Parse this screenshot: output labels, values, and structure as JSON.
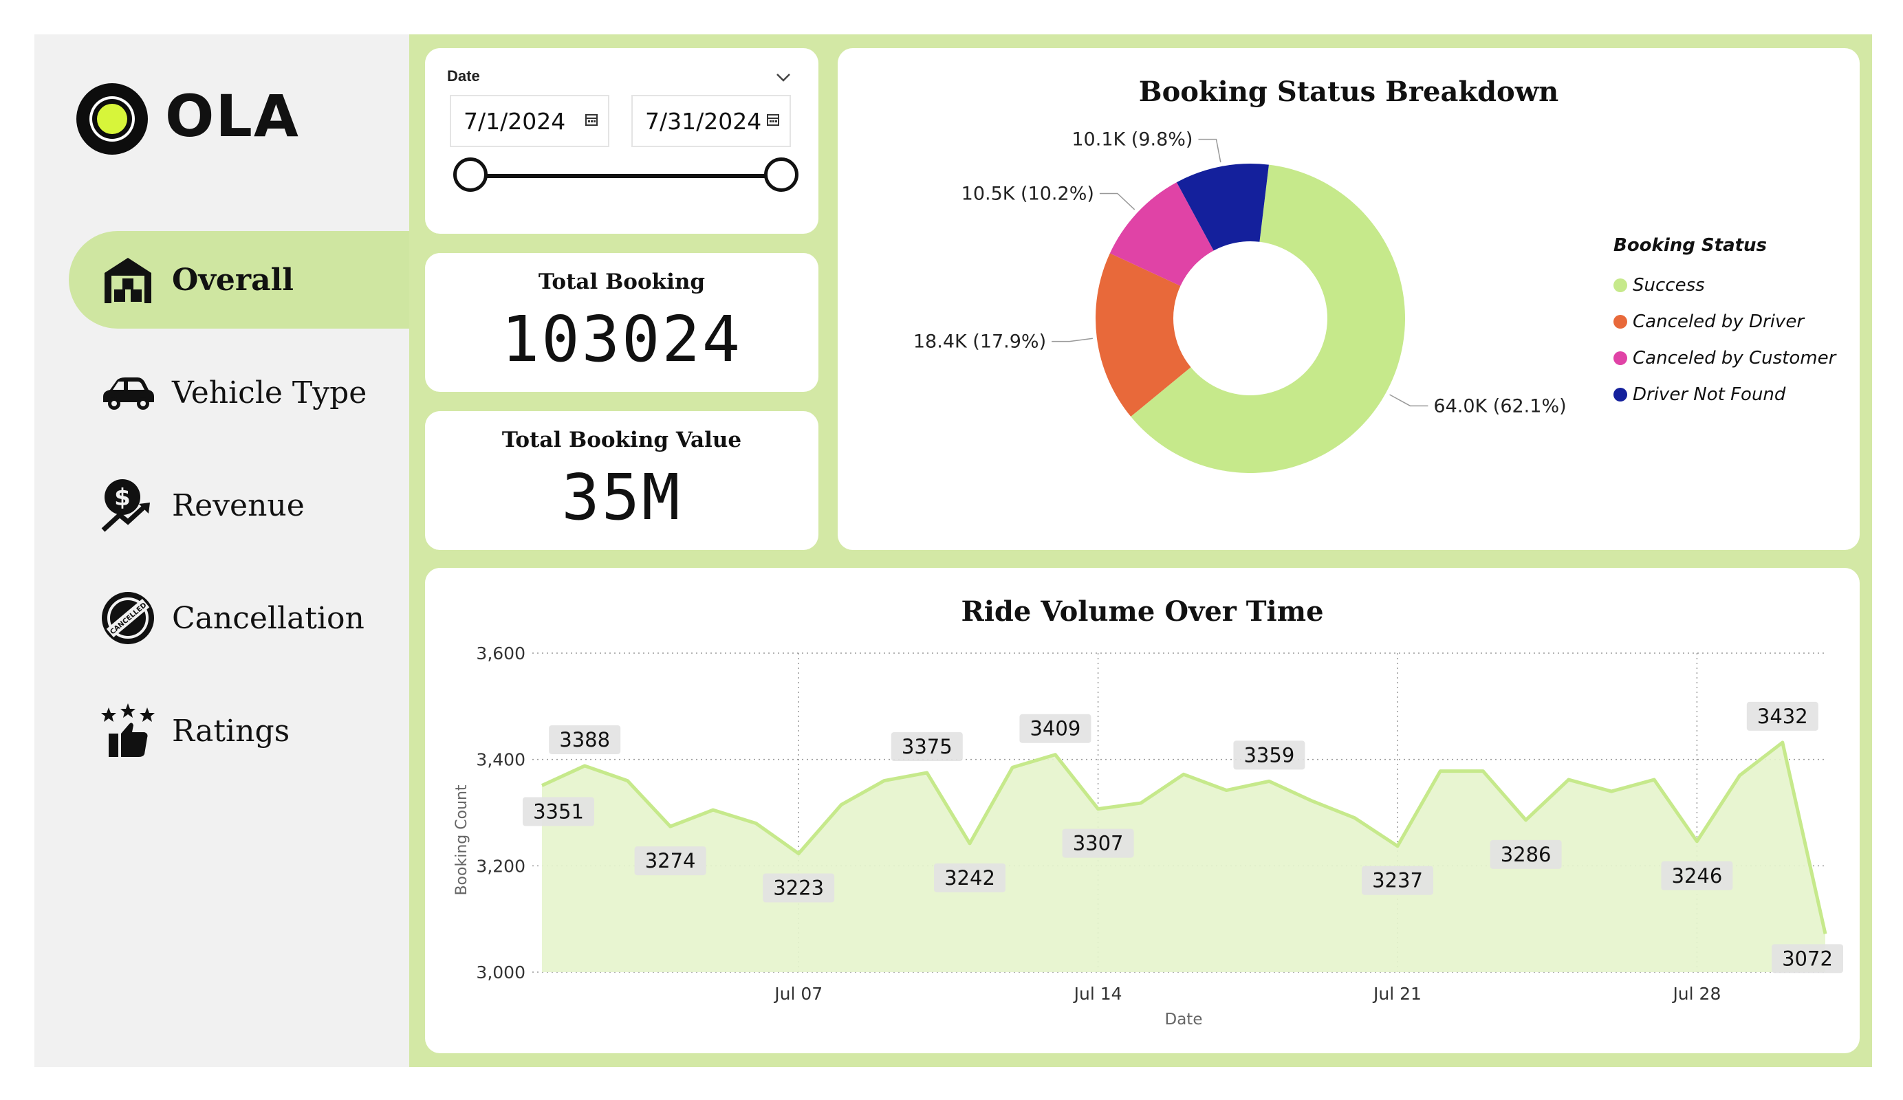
{
  "brand": {
    "name": "OLA",
    "accent": "#d7f53a",
    "sidebar_active_bg": "#cfe6a1"
  },
  "nav": {
    "items": [
      {
        "label": "Overall",
        "icon": "warehouse-icon",
        "active": true
      },
      {
        "label": "Vehicle Type",
        "icon": "car-icon",
        "active": false
      },
      {
        "label": "Revenue",
        "icon": "revenue-icon",
        "active": false
      },
      {
        "label": "Cancellation",
        "icon": "cancelled-stamp-icon",
        "active": false
      },
      {
        "label": "Ratings",
        "icon": "thumbs-up-stars-icon",
        "active": false
      }
    ]
  },
  "date_filter": {
    "label": "Date",
    "start": "7/1/2024",
    "end": "7/31/2024",
    "chevron_icon": "chevron-down-icon",
    "calendar_icon": "calendar-icon"
  },
  "kpis": {
    "total_booking": {
      "title": "Total Booking",
      "value": "103024"
    },
    "total_booking_value": {
      "title": "Total Booking Value",
      "value": "35M"
    }
  },
  "booking_status": {
    "legend_title": "Booking Status",
    "slices": [
      {
        "name": "Success",
        "value": 64.0,
        "label": "64.0K (62.1%)",
        "color": "#c6e98b"
      },
      {
        "name": "Canceled by Driver",
        "value": 18.4,
        "label": "18.4K (17.9%)",
        "color": "#e8693a"
      },
      {
        "name": "Canceled by Customer",
        "value": 10.5,
        "label": "10.5K (10.2%)",
        "color": "#e043a6"
      },
      {
        "name": "Driver Not Found",
        "value": 10.1,
        "label": "10.1K (9.8%)",
        "color": "#14209c"
      }
    ]
  },
  "chart_data": [
    {
      "type": "pie",
      "title": "Booking Status Breakdown",
      "categories": [
        "Success",
        "Canceled by Driver",
        "Canceled by Customer",
        "Driver Not Found"
      ],
      "values": [
        64.0,
        18.4,
        10.5,
        10.1
      ],
      "value_labels": [
        "64.0K (62.1%)",
        "18.4K (17.9%)",
        "10.5K (10.2%)",
        "10.1K (9.8%)"
      ],
      "legend_title": "Booking Status",
      "legend": "right",
      "donut": true
    },
    {
      "type": "area",
      "title": "Ride Volume Over Time",
      "xlabel": "Date",
      "ylabel": "Booking Count",
      "x": [
        "Jul 01",
        "Jul 02",
        "Jul 03",
        "Jul 04",
        "Jul 05",
        "Jul 06",
        "Jul 07",
        "Jul 08",
        "Jul 09",
        "Jul 10",
        "Jul 11",
        "Jul 12",
        "Jul 13",
        "Jul 14",
        "Jul 15",
        "Jul 16",
        "Jul 17",
        "Jul 18",
        "Jul 19",
        "Jul 20",
        "Jul 21",
        "Jul 22",
        "Jul 23",
        "Jul 24",
        "Jul 25",
        "Jul 26",
        "Jul 27",
        "Jul 28",
        "Jul 29",
        "Jul 30",
        "Jul 31"
      ],
      "values": [
        3351,
        3388,
        3360,
        3274,
        3305,
        3280,
        3223,
        3315,
        3360,
        3375,
        3242,
        3385,
        3409,
        3307,
        3318,
        3372,
        3342,
        3359,
        3322,
        3290,
        3237,
        3378,
        3378,
        3286,
        3362,
        3340,
        3362,
        3246,
        3370,
        3432,
        3072
      ],
      "data_labels": {
        "Jul 01": "3351",
        "Jul 02": "3388",
        "Jul 04": "3274",
        "Jul 07": "3223",
        "Jul 10": "3375",
        "Jul 11": "3242",
        "Jul 13": "3409",
        "Jul 14": "3307",
        "Jul 18": "3359",
        "Jul 21": "3237",
        "Jul 24": "3286",
        "Jul 28": "3246",
        "Jul 30": "3432",
        "Jul 31": "3072"
      },
      "x_ticks": [
        "Jul 07",
        "Jul 14",
        "Jul 21",
        "Jul 28"
      ],
      "y_ticks": [
        "3,000",
        "3,200",
        "3,400",
        "3,600"
      ],
      "ylim": [
        3000,
        3600
      ],
      "grid": true,
      "line_color": "#c6e98b",
      "fill_color": "#e6f4cc"
    }
  ]
}
